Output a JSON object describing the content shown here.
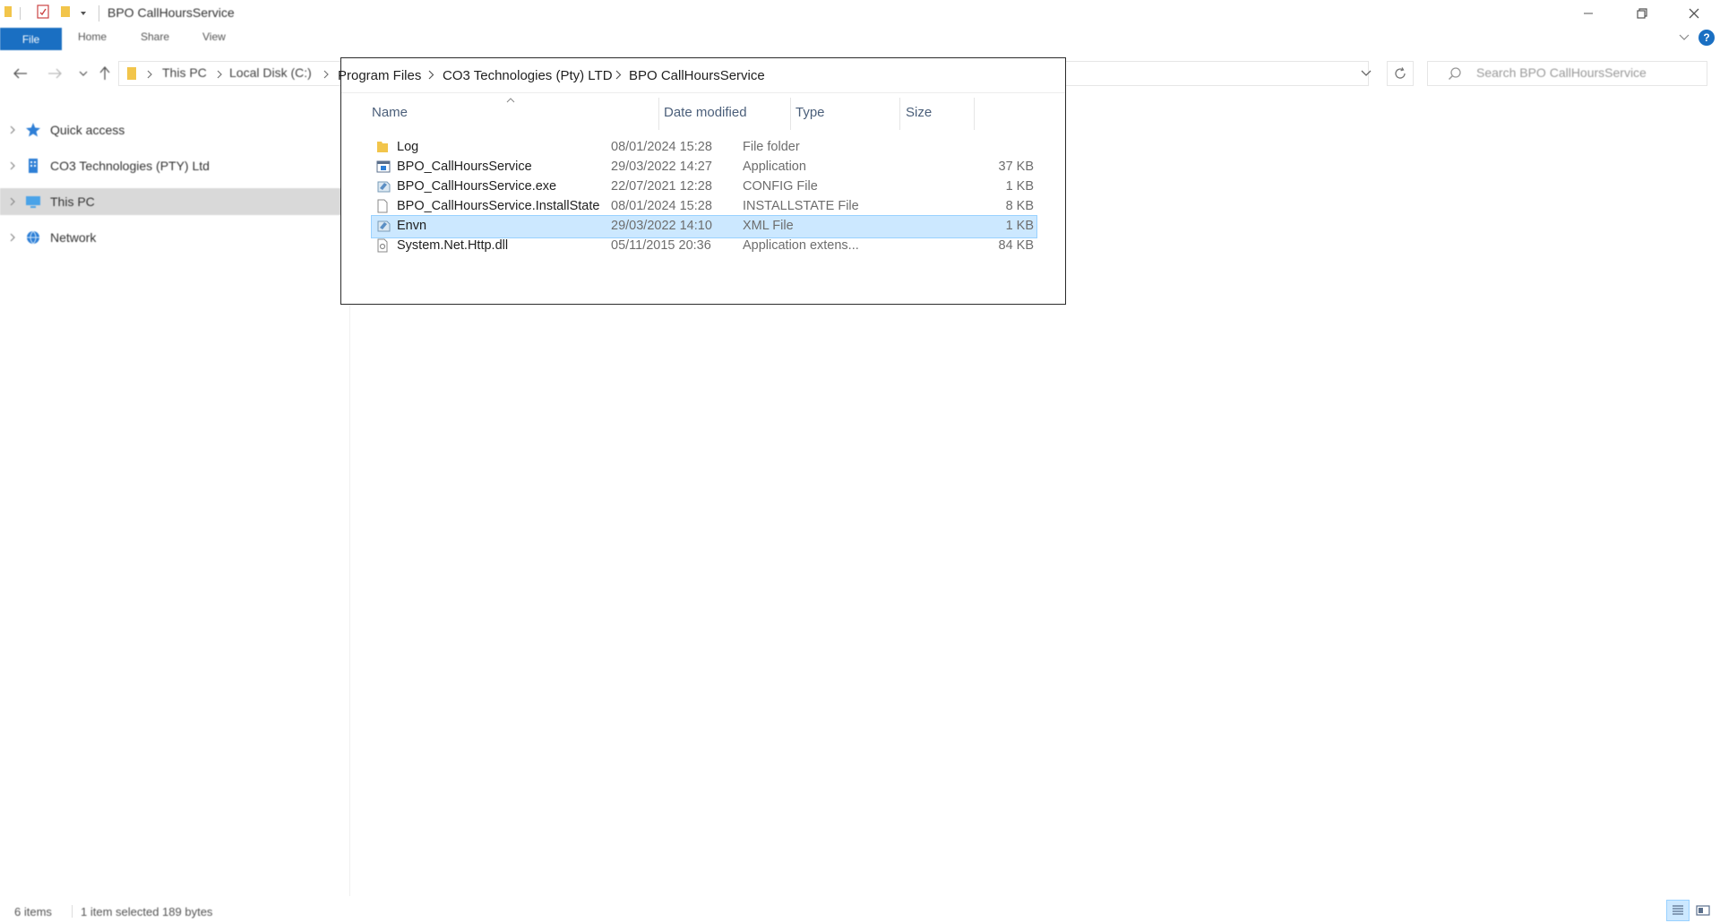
{
  "window": {
    "title": "BPO CallHoursService"
  },
  "ribbon": {
    "tabs": [
      "File",
      "Home",
      "Share",
      "View"
    ]
  },
  "address": {
    "blurred_crumbs": [
      "This PC",
      "Local Disk (C:)"
    ],
    "crumbs": [
      "Program Files",
      "CO3 Technologies (Pty) LTD",
      "BPO CallHoursService"
    ]
  },
  "search": {
    "placeholder": "Search BPO CallHoursService"
  },
  "sidebar": {
    "items": [
      {
        "label": "Quick access",
        "icon": "star-icon"
      },
      {
        "label": "CO3 Technologies (PTY) Ltd",
        "icon": "building-icon"
      },
      {
        "label": "This PC",
        "icon": "computer-icon",
        "selected": true
      },
      {
        "label": "Network",
        "icon": "network-icon"
      }
    ]
  },
  "columns": {
    "name": "Name",
    "date": "Date modified",
    "type": "Type",
    "size": "Size"
  },
  "files": [
    {
      "name": "Log",
      "date": "08/01/2024 15:28",
      "type": "File folder",
      "size": "",
      "icon": "folder-icon"
    },
    {
      "name": "BPO_CallHoursService",
      "date": "29/03/2022 14:27",
      "type": "Application",
      "size": "37 KB",
      "icon": "application-icon"
    },
    {
      "name": "BPO_CallHoursService.exe",
      "date": "22/07/2021 12:28",
      "type": "CONFIG File",
      "size": "1 KB",
      "icon": "config-file-icon"
    },
    {
      "name": "BPO_CallHoursService.InstallState",
      "date": "08/01/2024 15:28",
      "type": "INSTALLSTATE File",
      "size": "8 KB",
      "icon": "blank-file-icon"
    },
    {
      "name": "Envn",
      "date": "29/03/2022 14:10",
      "type": "XML File",
      "size": "1 KB",
      "icon": "xml-file-icon",
      "selected": true
    },
    {
      "name": "System.Net.Http.dll",
      "date": "05/11/2015 20:36",
      "type": "Application extens...",
      "size": "84 KB",
      "icon": "dll-file-icon"
    }
  ],
  "status": {
    "item_count": "6 items",
    "selection": "1 item selected  189 bytes"
  },
  "colors": {
    "accent": "#1a6fc2",
    "selection_bg": "#cce8ff",
    "selection_border": "#99d1ff",
    "folder": "#f2c54b"
  }
}
